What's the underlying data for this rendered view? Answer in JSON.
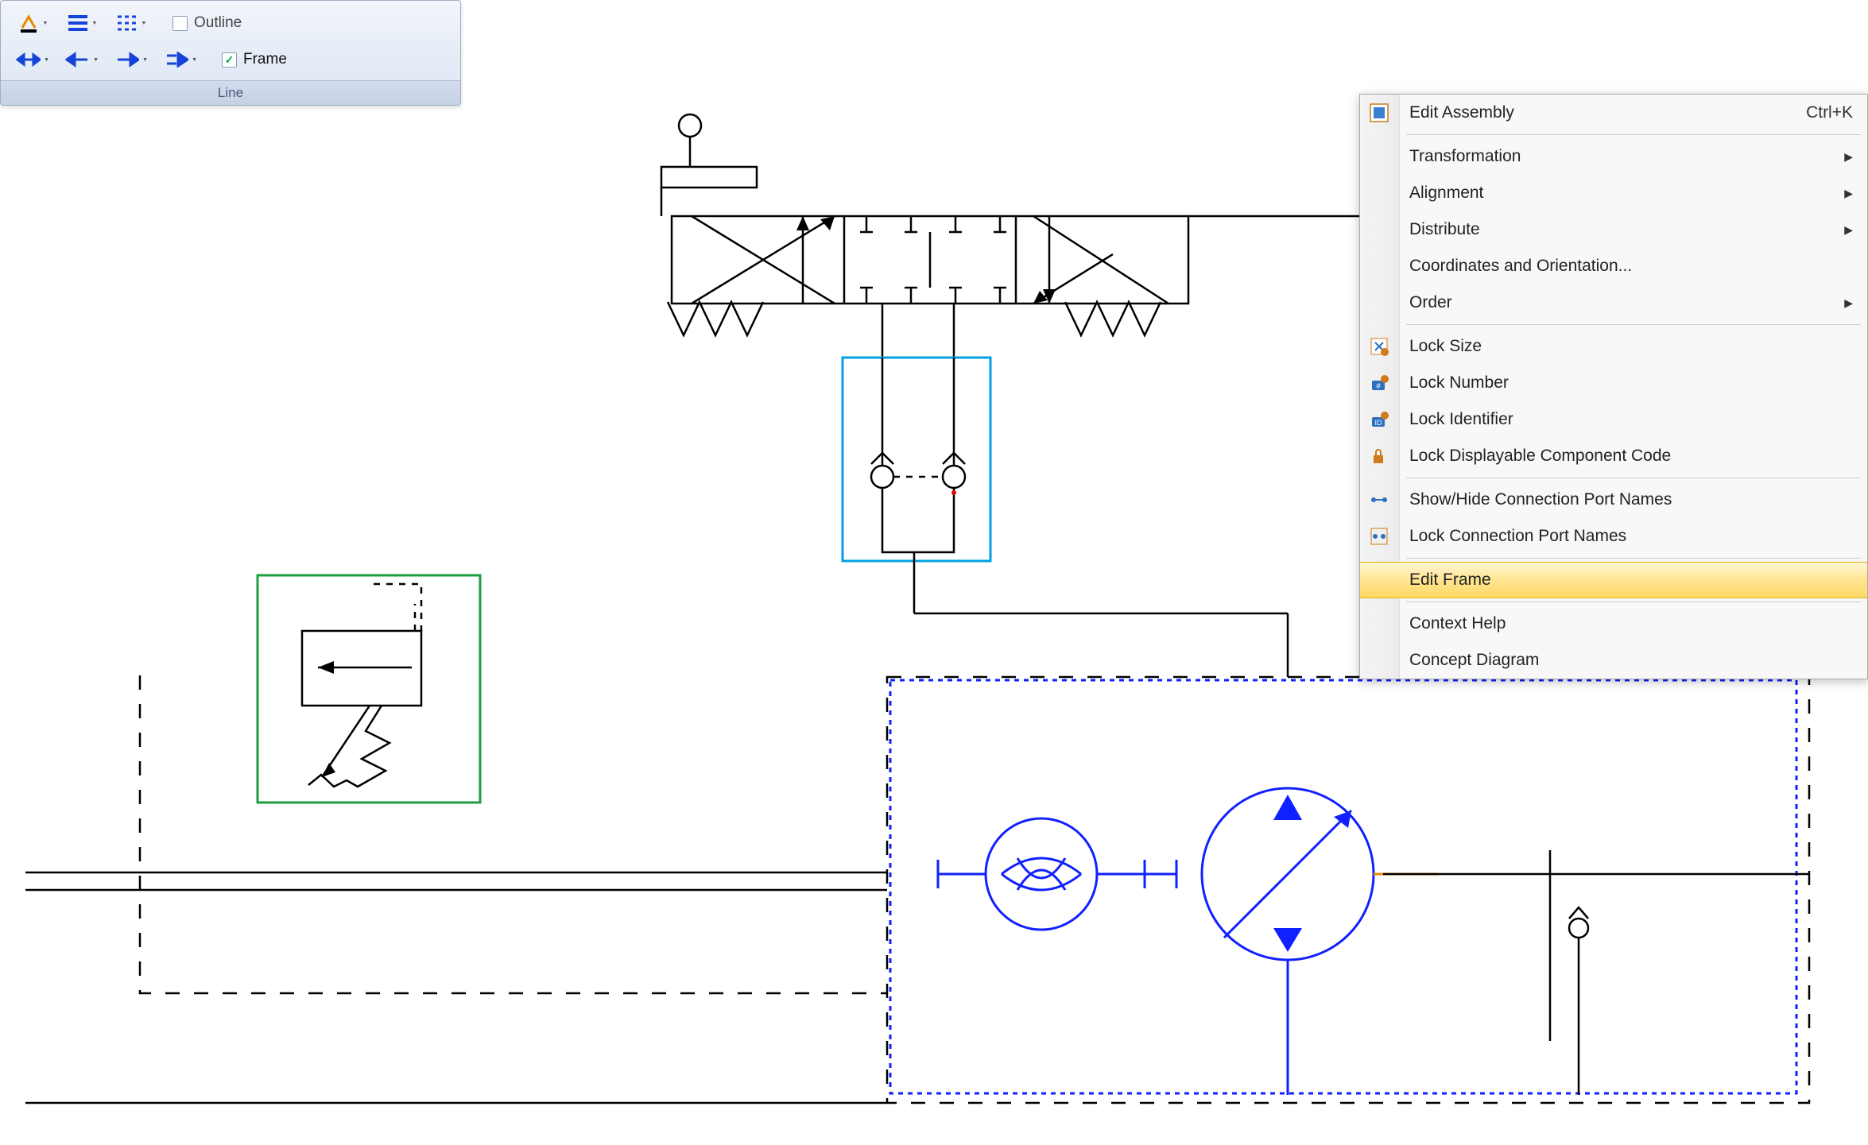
{
  "ribbon": {
    "title": "Line",
    "outline_label": "Outline",
    "frame_label": "Frame",
    "outline_checked": false,
    "frame_checked": true
  },
  "context_menu": {
    "items": [
      {
        "label": "Edit Assembly",
        "shortcut": "Ctrl+K",
        "icon": "edit-assembly-icon"
      },
      {
        "type": "sep"
      },
      {
        "label": "Transformation",
        "submenu": true
      },
      {
        "label": "Alignment",
        "submenu": true
      },
      {
        "label": "Distribute",
        "submenu": true
      },
      {
        "label": "Coordinates and Orientation..."
      },
      {
        "label": "Order",
        "submenu": true
      },
      {
        "type": "sep"
      },
      {
        "label": "Lock Size",
        "icon": "lock-size-icon"
      },
      {
        "label": "Lock Number",
        "icon": "lock-number-icon"
      },
      {
        "label": "Lock Identifier",
        "icon": "lock-identifier-icon"
      },
      {
        "label": "Lock Displayable Component Code",
        "icon": "lock-code-icon"
      },
      {
        "type": "sep"
      },
      {
        "label": "Show/Hide Connection Port Names",
        "icon": "show-hide-ports-icon"
      },
      {
        "label": "Lock Connection Port Names",
        "icon": "lock-ports-icon"
      },
      {
        "type": "sep"
      },
      {
        "label": "Edit Frame",
        "highlighted": true
      },
      {
        "type": "sep"
      },
      {
        "label": "Context Help"
      },
      {
        "label": "Concept Diagram"
      }
    ]
  },
  "schematic": {
    "selected_component_color": "#00a0e0",
    "selected_frame_color": "#1e9e3e",
    "assembly_dash_color": "#000",
    "drive_color": "#1020ff",
    "accent_orange": "#e88a00"
  }
}
